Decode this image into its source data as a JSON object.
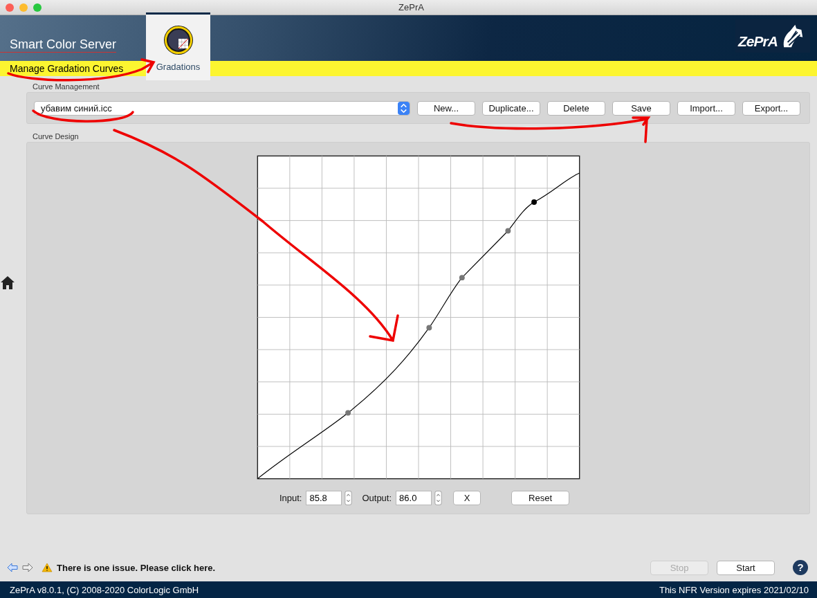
{
  "window": {
    "title": "ZePrA"
  },
  "header": {
    "app_title": "Smart Color Server",
    "logo": "ZePrA"
  },
  "section_title": "Manage Gradation Curves",
  "tabs": [
    {
      "label": "Gradations",
      "selected": true
    }
  ],
  "curve_management": {
    "label": "Curve Management",
    "profile": "убавим синий.icc",
    "buttons": [
      {
        "label": "New..."
      },
      {
        "label": "Duplicate..."
      },
      {
        "label": "Delete"
      },
      {
        "label": "Save"
      },
      {
        "label": "Import..."
      },
      {
        "label": "Export..."
      }
    ]
  },
  "curve_design": {
    "label": "Curve Design",
    "input_label": "Input:",
    "input_value": "85.8",
    "output_label": "Output:",
    "output_value": "86.0",
    "buttons": [
      {
        "label": "X",
        "kind": "small"
      },
      {
        "label": "Reset",
        "kind": "wide"
      }
    ]
  },
  "status_bar": {
    "help": "?",
    "message": "There is one issue. Please click here.",
    "buttons": [
      {
        "label": "Stop",
        "disabled": true
      },
      {
        "label": "Start",
        "disabled": false
      }
    ]
  },
  "footer": {
    "left": "ZePrA v8.0.1, (C) 2008-2020 ColorLogic GmbH",
    "right": "This NFR Version expires 2021/02/10"
  }
}
